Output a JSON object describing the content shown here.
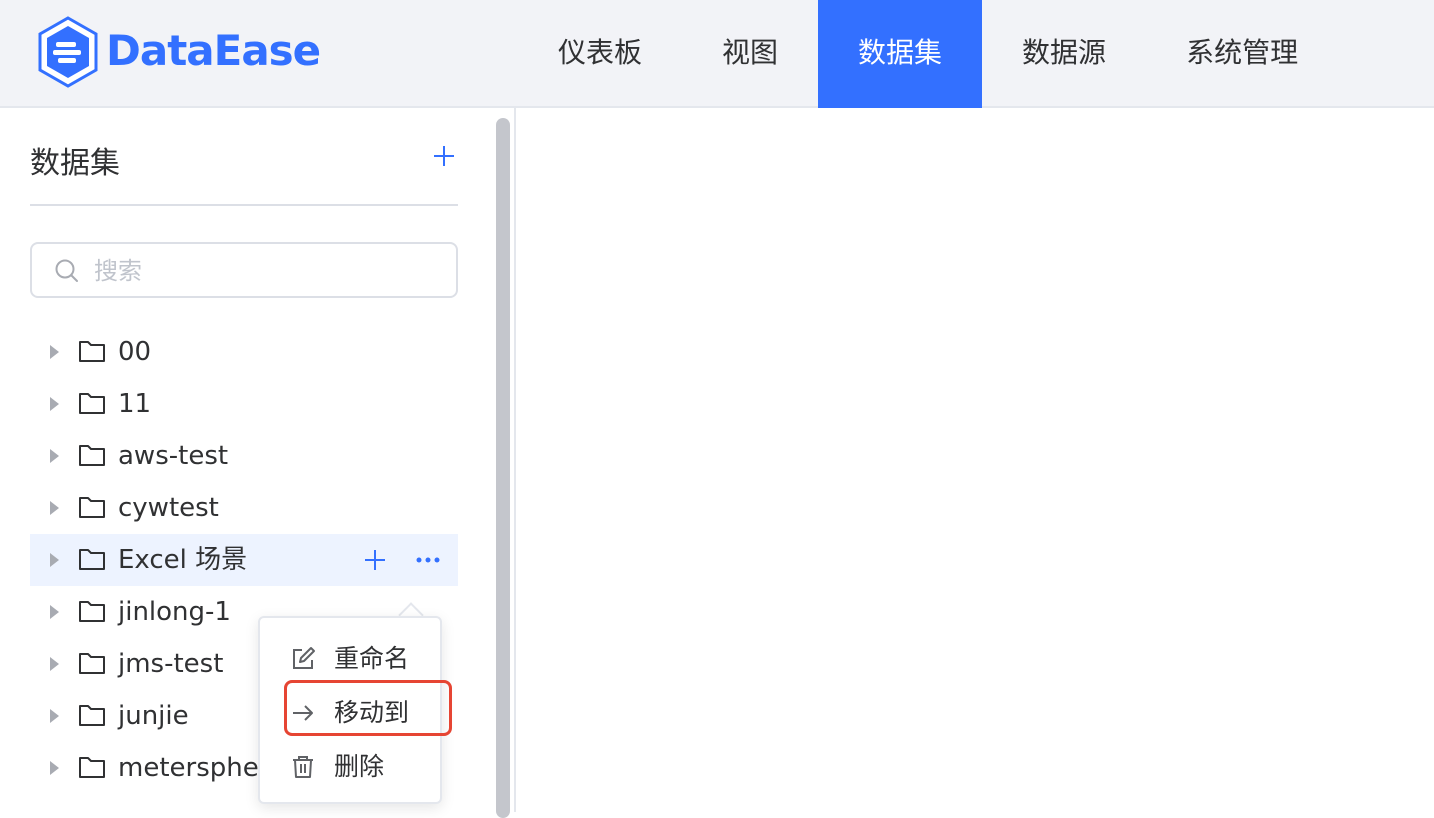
{
  "header": {
    "logo_text": "DataEase",
    "nav": [
      {
        "label": "仪表板"
      },
      {
        "label": "视图"
      },
      {
        "label": "数据集"
      },
      {
        "label": "数据源"
      },
      {
        "label": "系统管理"
      }
    ],
    "active_nav": "数据集"
  },
  "sidebar": {
    "title": "数据集",
    "add_icon": "plus-icon",
    "search": {
      "placeholder": "搜索",
      "value": ""
    },
    "tree": [
      {
        "label": "00"
      },
      {
        "label": "11"
      },
      {
        "label": "aws-test"
      },
      {
        "label": "cywtest"
      },
      {
        "label": "Excel 场景"
      },
      {
        "label": "jinlong-1"
      },
      {
        "label": "jms-test"
      },
      {
        "label": "junjie"
      },
      {
        "label": "metersphere"
      }
    ]
  },
  "context_menu": {
    "items": [
      {
        "label": "重命名",
        "icon": "edit-icon"
      },
      {
        "label": "移动到",
        "icon": "arrow-right-icon"
      },
      {
        "label": "删除",
        "icon": "trash-icon"
      }
    ],
    "highlighted": "移动到"
  },
  "colors": {
    "accent": "#3370ff",
    "highlight_border": "#e64533",
    "hover_row": "#edf3ff"
  }
}
